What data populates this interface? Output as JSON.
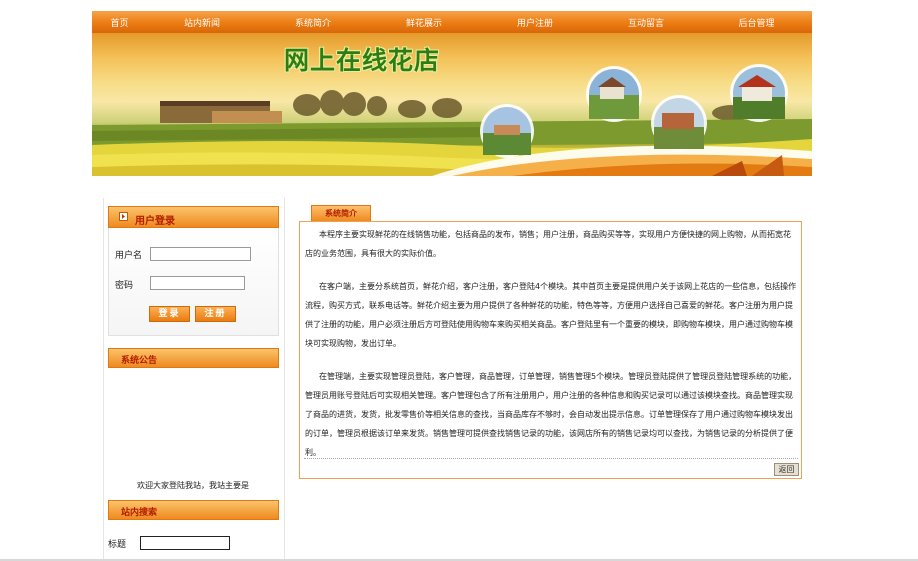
{
  "nav": {
    "items": [
      {
        "label": "首页"
      },
      {
        "label": "站内新闻"
      },
      {
        "label": "系统简介"
      },
      {
        "label": "鲜花展示"
      },
      {
        "label": "用户注册"
      },
      {
        "label": "互动留言"
      },
      {
        "label": "后台管理"
      }
    ]
  },
  "banner": {
    "title": "网上在线花店"
  },
  "sidebar": {
    "login": {
      "title": "用户登录",
      "username_label": "用户名",
      "username_value": "",
      "password_label": "密码",
      "password_value": "",
      "login_button": "登录",
      "register_button": "注册"
    },
    "notice": {
      "title": "系统公告",
      "marquee_text": "欢迎大家登陆我站，我站主要是"
    },
    "search": {
      "title": "站内搜索",
      "label": "标题",
      "value": ""
    }
  },
  "main": {
    "tab_label": "系统简介",
    "paragraphs": [
      "本程序主要实现鲜花的在线销售功能，包括商品的发布，销售；用户注册，商品购买等等，实现用户方便快捷的网上购物，从而拓宽花店的业务范围，具有很大的实际价值。",
      "在客户端，主要分系统首页，鲜花介绍，客户注册，客户登陆4个模块。其中首页主要是提供用户关于该网上花店的一些信息，包括操作流程，购买方式，联系电话等。鲜花介绍主要为用户提供了各种鲜花的功能，特色等等，方便用户选择自己喜爱的鲜花。客户注册为用户提供了注册的功能，用户必须注册后方可登陆使用购物车来购买相关商品。客户登陆里有一个重要的模块，即购物车模块，用户通过购物车模块可实现购物，发出订单。",
      "在管理端，主要实现管理员登陆，客户管理，商品管理，订单管理，销售管理5个模块。管理员登陆提供了管理员登陆管理系统的功能，管理员用账号登陆后可实现相关管理。客户管理包含了所有注册用户，用户注册的各种信息和购买记录可以通过该模块查找。商品管理实现了商品的进货，发货，批发零售价等相关信息的查找，当商品库存不够时，会自动发出提示信息。订单管理保存了用户通过购物车模块发出的订单，管理员根据该订单来发货。销售管理可提供查找销售记录的功能，该网店所有的销售记录均可以查找，为销售记录的分析提供了便利。"
    ],
    "back_button": "返回"
  }
}
